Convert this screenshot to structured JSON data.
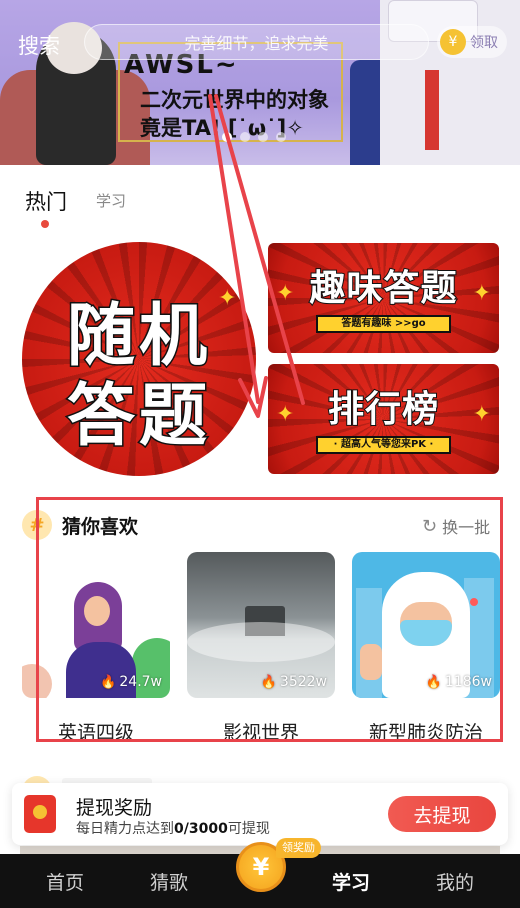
{
  "header": {
    "search_label": "搜索",
    "search_placeholder": "完善细节，追求完美",
    "coin_icon": "¥",
    "reward_button": "领取"
  },
  "banner": {
    "title_line1": "AWSL~",
    "title_line2": "二次元世界中的对象",
    "title_line3": "竟是TA! [˙ω˙]✧",
    "slides": 4,
    "active_slide": 0
  },
  "tabs": [
    {
      "label": "热门",
      "active": true
    },
    {
      "label": "学习",
      "active": false
    }
  ],
  "feature_cards": {
    "random": {
      "line1": "随机",
      "line2": "答题"
    },
    "fun": {
      "title": "趣味答题",
      "subtitle": "答题有趣味 >>go"
    },
    "rank": {
      "title": "排行榜",
      "subtitle": "· 超高人气等您来PK ·"
    }
  },
  "guess": {
    "icon": "#",
    "title": "猜你喜欢",
    "refresh_label": "换一批",
    "items": [
      {
        "label": "英语四级",
        "count": "24.7w"
      },
      {
        "label": "影视世界",
        "count": "3522w"
      },
      {
        "label": "新型肺炎防治",
        "count": "1186w"
      }
    ]
  },
  "withdraw": {
    "title": "提现奖励",
    "subtitle_prefix": "每日精力点达到",
    "subtitle_value": "0/3000",
    "subtitle_suffix": "可提现",
    "button": "去提现"
  },
  "nav": {
    "items": [
      "首页",
      "猜歌",
      "学习",
      "我的"
    ],
    "active": "学习",
    "coin_symbol": "¥",
    "badge": "领奖励"
  },
  "colors": {
    "accent_red": "#e8434a",
    "card_red": "#c81b12",
    "gold": "#f5c233",
    "nav_bg": "#111111"
  }
}
